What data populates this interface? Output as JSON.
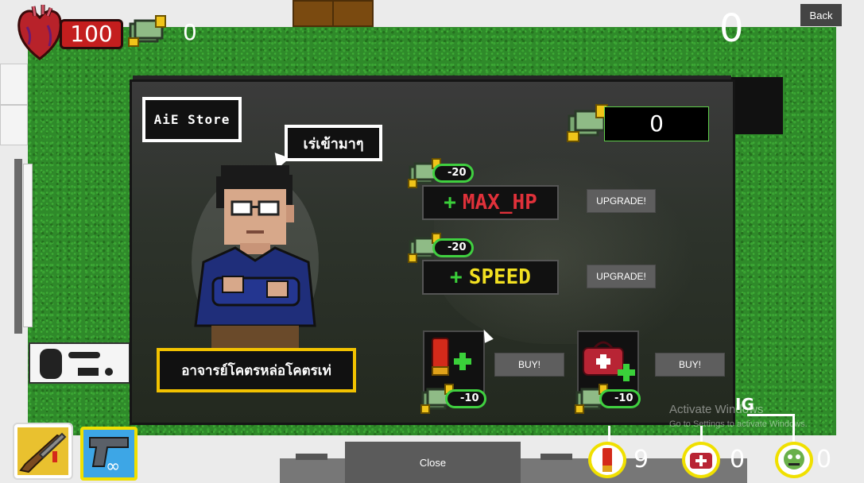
{
  "hud": {
    "hp": "100",
    "money": "0",
    "score": "0",
    "back_label": "Back"
  },
  "store": {
    "title": "AiE Store",
    "speech": "เร่เข้ามาๆ",
    "npc_name": "อาจารย์โคตรหล่อโคตรเท่",
    "money_balance": "0",
    "upgrades": [
      {
        "label": "MAX_HP",
        "plus": "+",
        "cost": "-20",
        "button": "UPGRADE!"
      },
      {
        "label": "SPEED",
        "plus": "+",
        "cost": "-20",
        "button": "UPGRADE!"
      }
    ],
    "items": [
      {
        "name": "ammo-shell",
        "cost": "-10",
        "button": "BUY!"
      },
      {
        "name": "medkit",
        "cost": "-10",
        "button": "BUY!"
      }
    ]
  },
  "bottom": {
    "close_label": "Close",
    "weapons": [
      {
        "name": "shotgun",
        "selected": true
      },
      {
        "name": "pistol",
        "ammo": "∞"
      }
    ],
    "ammo_count": "9",
    "medkit_count": "0",
    "zombie_count": "0",
    "mig_label": "IG"
  },
  "watermark": {
    "line1": "Activate Windows",
    "line2": "Go to Settings to activate Windows."
  },
  "colors": {
    "grass": "#2f8a2a",
    "hp_red": "#c41e1e",
    "accent_green": "#40d040",
    "accent_yellow": "#f0e000",
    "max_hp_red": "#e0313a",
    "speed_yellow": "#f2e021"
  }
}
